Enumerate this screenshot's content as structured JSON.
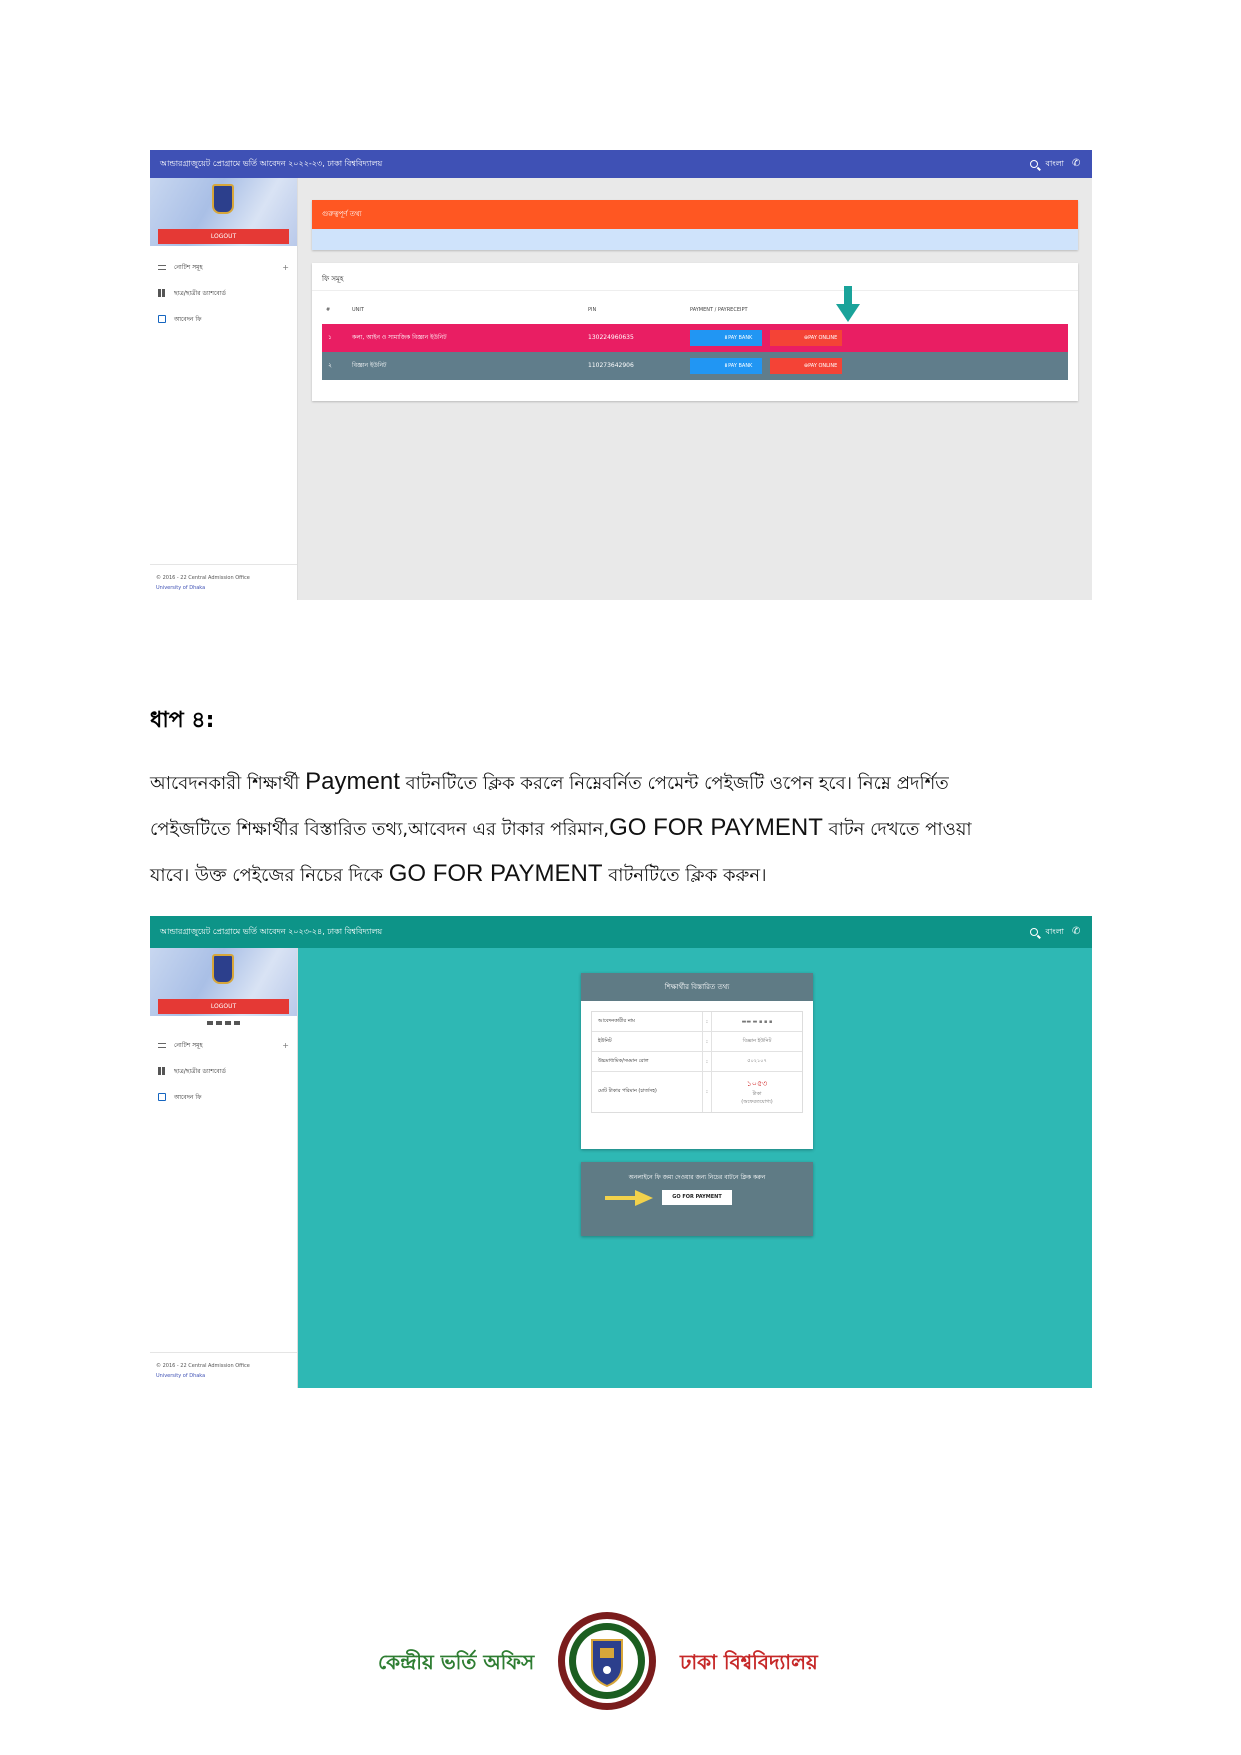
{
  "shot1": {
    "title": "আন্ডারগ্রাজুয়েট প্রোগ্রামে ভর্তি আবেদন ২০২২-২৩, ঢাকা বিশ্ববিদ্যালয়",
    "lang": "বাংলা",
    "logout": "LOGOUT",
    "menu": [
      "নোটিশ সমূহ",
      "ছাত্র/ছাত্রীর ড্যাশবোর্ড",
      "আবেদন ফি"
    ],
    "footer_line1": "© 2016 - 22 Central Admission Office",
    "footer_line2": "University of Dhaka",
    "important_title": "গুরুত্বপূর্ণ তথ্য",
    "fee_title": "ফি সমূহ",
    "headers": [
      "#",
      "UNIT",
      "PIN",
      "PAYMENT / PAYRECEIPT"
    ],
    "rows": [
      {
        "no": "১",
        "unit": "কলা, আইন ও সামাজিক বিজ্ঞান ইউনিট",
        "pin": "130224960635",
        "bank": "PAY BANK",
        "online": "PAY ONLINE"
      },
      {
        "no": "২",
        "unit": "বিজ্ঞান ইউনিট",
        "pin": "110273642906",
        "bank": "PAY BANK",
        "online": "PAY ONLINE"
      }
    ]
  },
  "step": {
    "title": "ধাপ ৪:",
    "line1_a": "আবেদনকারী শিক্ষার্থী ",
    "line1_b": "Payment",
    "line1_c": " বাটনটিতে ক্লিক করলে নিম্নেবর্নিত পেমেন্ট পেইজটি ওপেন হবে। নিম্নে প্রদর্শিত",
    "line2_a": "পেইজটিতে শিক্ষার্থীর বিস্তারিত তথ্য,আবেদন এর টাকার পরিমান,",
    "line2_b": "GO FOR PAYMENT",
    "line2_c": " বাটন দেখতে পাওয়া",
    "line3_a": "যাবে। উক্ত পেইজের নিচের দিকে ",
    "line3_b": "GO FOR PAYMENT",
    "line3_c": " বাটনটিতে ক্লিক করুন।"
  },
  "shot2": {
    "title": "আন্ডারগ্রাজুয়েট প্রোগ্রামে ভর্তি আবেদন ২০২৩-২৪, ঢাকা বিশ্ববিদ্যালয়",
    "lang": "বাংলা",
    "logout": "LOGOUT",
    "menu": [
      "নোটিশ সমূহ",
      "ছাত্র/ছাত্রীর ড্যাশবোর্ড",
      "আবেদন ফি"
    ],
    "footer_line1": "© 2016 - 22 Central Admission Office",
    "footer_line2": "University of Dhaka",
    "info_title": "শিক্ষার্থীর বিস্তারিত তথ্য",
    "info_rows": [
      {
        "key": "আবেদনকারীর নাম",
        "value": "▬▬ ▬  ▪ ▪ ▪"
      },
      {
        "key": "ইউনিট",
        "value": "বিজ্ঞান ইউনিট"
      },
      {
        "key": "উচ্চমাধ্যমিক/সমমান রোল",
        "value": "৫০২১০৭"
      },
      {
        "key": "মোট টাকার পরিমান (চার্জসহ)",
        "value_amount": "১০৫৩",
        "value_unit": "টাকা",
        "value_note": "(অফেরতযোগ্য)"
      }
    ],
    "pay_note": "অনলাইনে ফি জমা দেওয়ার জন্য নিচের বাটনে ক্লিক করুন",
    "go_button": "GO FOR PAYMENT"
  },
  "footer": {
    "left": "কেন্দ্রীয় ভর্তি অফিস",
    "right": "ঢাকা বিশ্ববিদ্যালয়"
  },
  "colors": {
    "shot1_topbar": "#3f51b5",
    "shot2_topbar": "#0d9488",
    "shot2_bg": "#2eb8b4",
    "orange_header": "#ff5722",
    "row1": "#e91e63",
    "row2": "#607d8b",
    "pay_bank": "#2196f3",
    "pay_online": "#f44336"
  }
}
